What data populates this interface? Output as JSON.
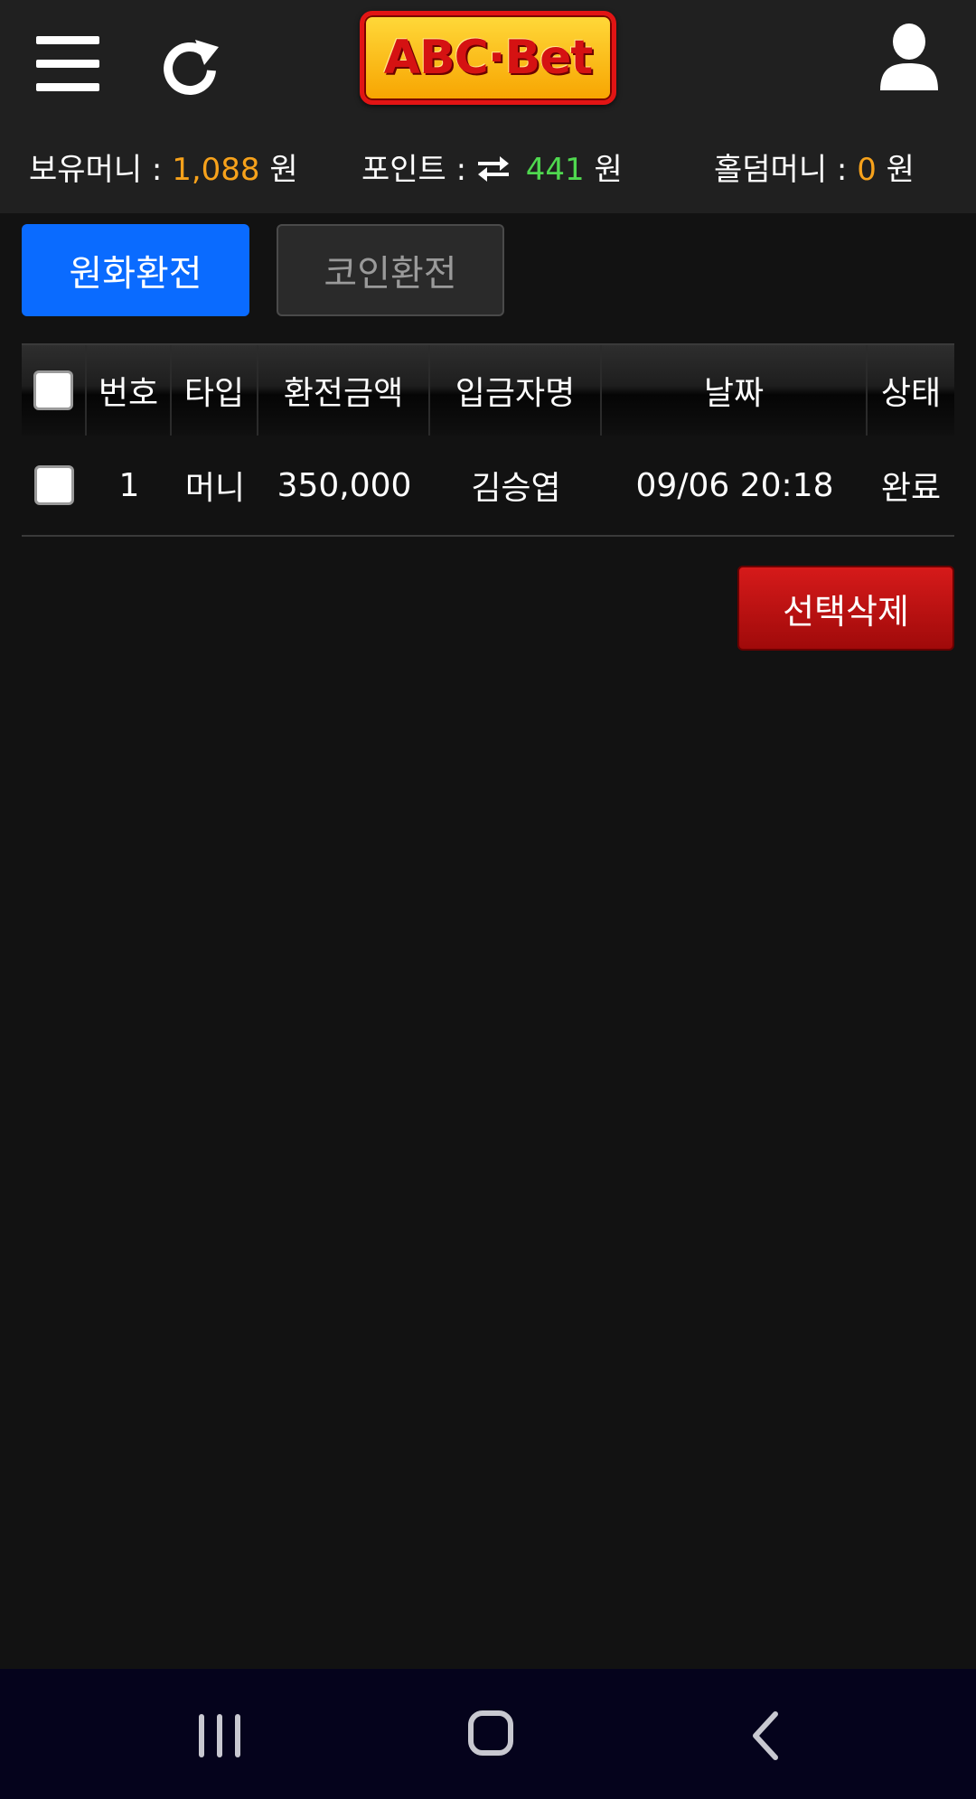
{
  "header": {
    "logo_text": "ABC·Bet",
    "balances": {
      "money_label": "보유머니 :",
      "money_value": "1,088",
      "money_unit": "원",
      "point_label": "포인트 :",
      "point_value": "441",
      "point_unit": "원",
      "hold_label": "홀덤머니 :",
      "hold_value": "0",
      "hold_unit": "원"
    },
    "icons": [
      "hamburger-menu-icon",
      "refresh-icon",
      "user-icon",
      "swap-arrows-icon"
    ]
  },
  "tabs": [
    {
      "label": "원화환전",
      "active": true
    },
    {
      "label": "코인환전",
      "active": false
    }
  ],
  "table": {
    "columns": [
      "번호",
      "타입",
      "환전금액",
      "입금자명",
      "날짜",
      "상태"
    ],
    "rows": [
      {
        "no": "1",
        "type": "머니",
        "amount": "350,000",
        "name": "김승엽",
        "date": "09/06 20:18",
        "status": "완료"
      }
    ]
  },
  "actions": {
    "delete_selected": "선택삭제"
  },
  "colors": {
    "accent_blue": "#0a6bff",
    "money_orange": "#f7a21b",
    "point_green": "#4fd84f",
    "delete_red": "#c01212",
    "header_bg": "#202020",
    "page_bg": "#121212",
    "navbar_bg": "#05031c"
  }
}
